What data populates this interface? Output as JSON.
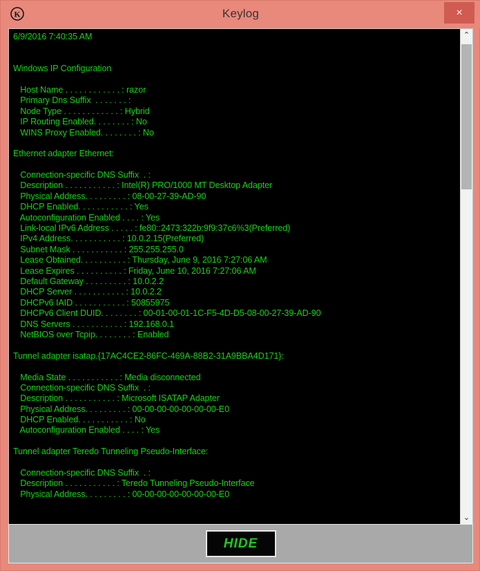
{
  "window": {
    "title": "Keylog",
    "app_icon": "circled-k-icon",
    "titlebar_color": "#E8897C",
    "close_label": "×"
  },
  "console": {
    "background_color": "#000000",
    "text_color": "#15D215",
    "lines": [
      "6/9/2016 7:40:35 AM",
      "",
      "",
      "Windows IP Configuration",
      "",
      "   Host Name . . . . . . . . . . . . : razor",
      "   Primary Dns Suffix  . . . . . . . :",
      "   Node Type . . . . . . . . . . . . : Hybrid",
      "   IP Routing Enabled. . . . . . . . : No",
      "   WINS Proxy Enabled. . . . . . . . : No",
      "",
      "Ethernet adapter Ethernet:",
      "",
      "   Connection-specific DNS Suffix  . :",
      "   Description . . . . . . . . . . . : Intel(R) PRO/1000 MT Desktop Adapter",
      "   Physical Address. . . . . . . . . : 08-00-27-39-AD-90",
      "   DHCP Enabled. . . . . . . . . . . : Yes",
      "   Autoconfiguration Enabled . . . . : Yes",
      "   Link-local IPv6 Address . . . . . : fe80::2473:322b:9f9:37c6%3(Preferred)",
      "   IPv4 Address. . . . . . . . . . . : 10.0.2.15(Preferred)",
      "   Subnet Mask . . . . . . . . . . . : 255.255.255.0",
      "   Lease Obtained. . . . . . . . . . : Thursday, June 9, 2016 7:27:06 AM",
      "   Lease Expires . . . . . . . . . . : Friday, June 10, 2016 7:27:06 AM",
      "   Default Gateway . . . . . . . . . : 10.0.2.2",
      "   DHCP Server . . . . . . . . . . . : 10.0.2.2",
      "   DHCPv6 IAID . . . . . . . . . . . : 50855975",
      "   DHCPv6 Client DUID. . . . . . . . : 00-01-00-01-1C-F5-4D-D5-08-00-27-39-AD-90",
      "   DNS Servers . . . . . . . . . . . : 192.168.0.1",
      "   NetBIOS over Tcpip. . . . . . . . : Enabled",
      "",
      "Tunnel adapter isatap.{17AC4CE2-86FC-469A-88B2-31A9BBA4D171}:",
      "",
      "   Media State . . . . . . . . . . . : Media disconnected",
      "   Connection-specific DNS Suffix  . :",
      "   Description . . . . . . . . . . . : Microsoft ISATAP Adapter",
      "   Physical Address. . . . . . . . . : 00-00-00-00-00-00-00-E0",
      "   DHCP Enabled. . . . . . . . . . . : No",
      "   Autoconfiguration Enabled . . . . : Yes",
      "",
      "Tunnel adapter Teredo Tunneling Pseudo-Interface:",
      "",
      "   Connection-specific DNS Suffix  . :",
      "   Description . . . . . . . . . . . : Teredo Tunneling Pseudo-Interface",
      "   Physical Address. . . . . . . . . : 00-00-00-00-00-00-00-E0"
    ]
  },
  "scrollbar": {
    "up_arrow": "⌃",
    "down_arrow": "⌄"
  },
  "footer": {
    "hide_label": "HIDE"
  }
}
